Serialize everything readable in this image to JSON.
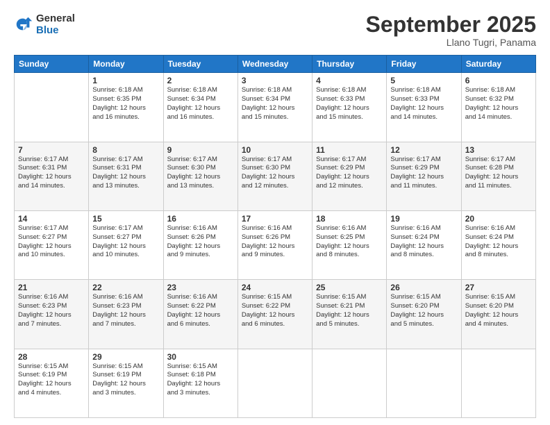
{
  "header": {
    "logo_line1": "General",
    "logo_line2": "Blue",
    "month": "September 2025",
    "location": "Llano Tugri, Panama"
  },
  "weekdays": [
    "Sunday",
    "Monday",
    "Tuesday",
    "Wednesday",
    "Thursday",
    "Friday",
    "Saturday"
  ],
  "weeks": [
    [
      {
        "day": "",
        "info": ""
      },
      {
        "day": "1",
        "info": "Sunrise: 6:18 AM\nSunset: 6:35 PM\nDaylight: 12 hours\nand 16 minutes."
      },
      {
        "day": "2",
        "info": "Sunrise: 6:18 AM\nSunset: 6:34 PM\nDaylight: 12 hours\nand 16 minutes."
      },
      {
        "day": "3",
        "info": "Sunrise: 6:18 AM\nSunset: 6:34 PM\nDaylight: 12 hours\nand 15 minutes."
      },
      {
        "day": "4",
        "info": "Sunrise: 6:18 AM\nSunset: 6:33 PM\nDaylight: 12 hours\nand 15 minutes."
      },
      {
        "day": "5",
        "info": "Sunrise: 6:18 AM\nSunset: 6:33 PM\nDaylight: 12 hours\nand 14 minutes."
      },
      {
        "day": "6",
        "info": "Sunrise: 6:18 AM\nSunset: 6:32 PM\nDaylight: 12 hours\nand 14 minutes."
      }
    ],
    [
      {
        "day": "7",
        "info": "Sunrise: 6:17 AM\nSunset: 6:31 PM\nDaylight: 12 hours\nand 14 minutes."
      },
      {
        "day": "8",
        "info": "Sunrise: 6:17 AM\nSunset: 6:31 PM\nDaylight: 12 hours\nand 13 minutes."
      },
      {
        "day": "9",
        "info": "Sunrise: 6:17 AM\nSunset: 6:30 PM\nDaylight: 12 hours\nand 13 minutes."
      },
      {
        "day": "10",
        "info": "Sunrise: 6:17 AM\nSunset: 6:30 PM\nDaylight: 12 hours\nand 12 minutes."
      },
      {
        "day": "11",
        "info": "Sunrise: 6:17 AM\nSunset: 6:29 PM\nDaylight: 12 hours\nand 12 minutes."
      },
      {
        "day": "12",
        "info": "Sunrise: 6:17 AM\nSunset: 6:29 PM\nDaylight: 12 hours\nand 11 minutes."
      },
      {
        "day": "13",
        "info": "Sunrise: 6:17 AM\nSunset: 6:28 PM\nDaylight: 12 hours\nand 11 minutes."
      }
    ],
    [
      {
        "day": "14",
        "info": "Sunrise: 6:17 AM\nSunset: 6:27 PM\nDaylight: 12 hours\nand 10 minutes."
      },
      {
        "day": "15",
        "info": "Sunrise: 6:17 AM\nSunset: 6:27 PM\nDaylight: 12 hours\nand 10 minutes."
      },
      {
        "day": "16",
        "info": "Sunrise: 6:16 AM\nSunset: 6:26 PM\nDaylight: 12 hours\nand 9 minutes."
      },
      {
        "day": "17",
        "info": "Sunrise: 6:16 AM\nSunset: 6:26 PM\nDaylight: 12 hours\nand 9 minutes."
      },
      {
        "day": "18",
        "info": "Sunrise: 6:16 AM\nSunset: 6:25 PM\nDaylight: 12 hours\nand 8 minutes."
      },
      {
        "day": "19",
        "info": "Sunrise: 6:16 AM\nSunset: 6:24 PM\nDaylight: 12 hours\nand 8 minutes."
      },
      {
        "day": "20",
        "info": "Sunrise: 6:16 AM\nSunset: 6:24 PM\nDaylight: 12 hours\nand 8 minutes."
      }
    ],
    [
      {
        "day": "21",
        "info": "Sunrise: 6:16 AM\nSunset: 6:23 PM\nDaylight: 12 hours\nand 7 minutes."
      },
      {
        "day": "22",
        "info": "Sunrise: 6:16 AM\nSunset: 6:23 PM\nDaylight: 12 hours\nand 7 minutes."
      },
      {
        "day": "23",
        "info": "Sunrise: 6:16 AM\nSunset: 6:22 PM\nDaylight: 12 hours\nand 6 minutes."
      },
      {
        "day": "24",
        "info": "Sunrise: 6:15 AM\nSunset: 6:22 PM\nDaylight: 12 hours\nand 6 minutes."
      },
      {
        "day": "25",
        "info": "Sunrise: 6:15 AM\nSunset: 6:21 PM\nDaylight: 12 hours\nand 5 minutes."
      },
      {
        "day": "26",
        "info": "Sunrise: 6:15 AM\nSunset: 6:20 PM\nDaylight: 12 hours\nand 5 minutes."
      },
      {
        "day": "27",
        "info": "Sunrise: 6:15 AM\nSunset: 6:20 PM\nDaylight: 12 hours\nand 4 minutes."
      }
    ],
    [
      {
        "day": "28",
        "info": "Sunrise: 6:15 AM\nSunset: 6:19 PM\nDaylight: 12 hours\nand 4 minutes."
      },
      {
        "day": "29",
        "info": "Sunrise: 6:15 AM\nSunset: 6:19 PM\nDaylight: 12 hours\nand 3 minutes."
      },
      {
        "day": "30",
        "info": "Sunrise: 6:15 AM\nSunset: 6:18 PM\nDaylight: 12 hours\nand 3 minutes."
      },
      {
        "day": "",
        "info": ""
      },
      {
        "day": "",
        "info": ""
      },
      {
        "day": "",
        "info": ""
      },
      {
        "day": "",
        "info": ""
      }
    ]
  ]
}
